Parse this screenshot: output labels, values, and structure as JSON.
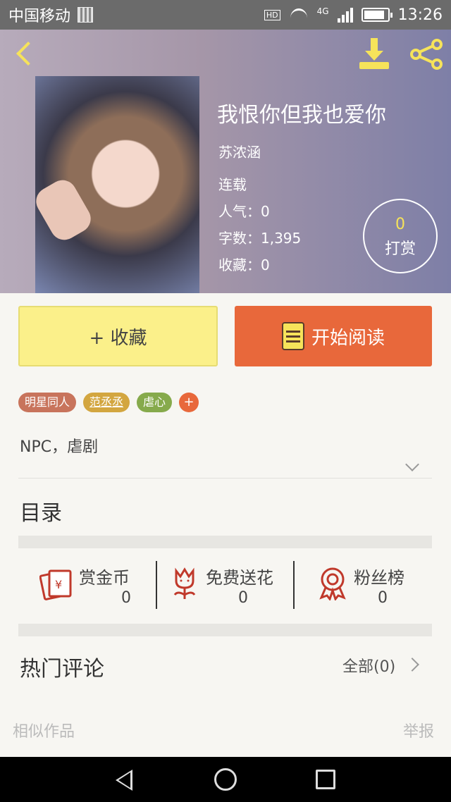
{
  "status_bar": {
    "carrier": "中国移动",
    "hd": "HD",
    "network": "4G",
    "time": "13:26"
  },
  "book": {
    "title": "我恨你但我也爱你",
    "author": "苏浓涵",
    "status": "连载",
    "popularity": "人气：0",
    "word_count": "字数：1,395",
    "favorites": "收藏：0",
    "tip_count": "0",
    "tip_label": "打赏"
  },
  "actions": {
    "collect": "+ 收藏",
    "read": "开始阅读"
  },
  "tags": [
    {
      "label": "明星同人",
      "color": "#c8745c"
    },
    {
      "label": "范丞丞",
      "color": "#d3a640"
    },
    {
      "label": "虐心",
      "color": "#86aa4c"
    }
  ],
  "tag_add": "+",
  "description": "NPC，虐剧",
  "toc_title": "目录",
  "stats": {
    "reward_coin": {
      "label": "赏金币",
      "value": "0"
    },
    "free_flower": {
      "label": "免费送花",
      "value": "0"
    },
    "fan_rank": {
      "label": "粉丝榜",
      "value": "0"
    }
  },
  "comments": {
    "title": "热门评论",
    "all_link": "全部(0)"
  },
  "footer": {
    "similar": "相似作品",
    "report": "举报"
  },
  "colors": {
    "accent_yellow": "#f6e35a",
    "accent_orange": "#e8683b",
    "icon_red": "#c0392b"
  }
}
